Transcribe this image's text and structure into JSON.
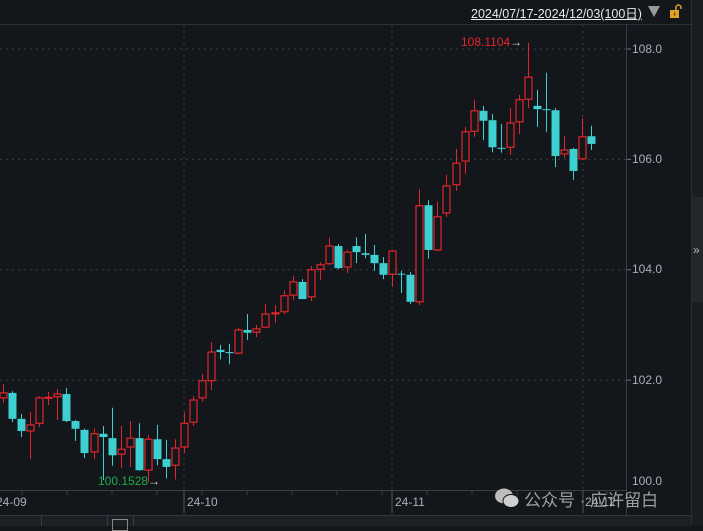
{
  "header": {
    "date_range": "2024/07/17-2024/12/03(100日)",
    "dropdown_icon": "triangle-down-icon",
    "lock_icon": "unlock-icon"
  },
  "price_axis": {
    "labels": [
      "108.0",
      "106.0",
      "104.0",
      "102.0",
      "100.0"
    ]
  },
  "time_axis": {
    "labels": [
      "24-09",
      "24-10",
      "24-11",
      "24-12"
    ]
  },
  "markers": {
    "max_label": "108.1104",
    "min_label": "100.1528",
    "arrow": "→"
  },
  "right_panel": {
    "expand_label": "»"
  },
  "watermark": {
    "text": "公众号 · 应许留白"
  },
  "colors": {
    "up": "#e0262b",
    "down": "#3ecfd0",
    "grid": "#3a3e45",
    "background": "#13161b"
  },
  "chart_data": {
    "type": "candlestick",
    "ylim": [
      100.0,
      108.2
    ],
    "yticks": [
      100,
      102,
      104,
      106,
      108
    ],
    "candles_ohlc": [
      [
        101.68,
        101.93,
        101.59,
        101.77
      ],
      [
        101.77,
        101.8,
        101.24,
        101.3
      ],
      [
        101.3,
        101.39,
        100.97,
        101.08
      ],
      [
        101.08,
        101.42,
        100.57,
        101.19
      ],
      [
        101.22,
        101.71,
        101.15,
        101.68
      ],
      [
        101.68,
        101.79,
        101.55,
        101.69
      ],
      [
        101.7,
        101.84,
        101.28,
        101.75
      ],
      [
        101.75,
        101.86,
        101.24,
        101.26
      ],
      [
        101.26,
        101.28,
        100.9,
        101.12
      ],
      [
        101.1,
        101.12,
        100.59,
        100.68
      ],
      [
        100.7,
        101.13,
        100.57,
        101.03
      ],
      [
        101.03,
        101.17,
        100.19,
        100.97
      ],
      [
        100.95,
        101.5,
        100.45,
        100.64
      ],
      [
        100.66,
        101.17,
        100.41,
        100.75
      ],
      [
        100.79,
        101.26,
        100.43,
        100.95
      ],
      [
        100.95,
        101.22,
        100.36,
        100.37
      ],
      [
        100.37,
        101.01,
        100.1528,
        100.93
      ],
      [
        100.93,
        101.19,
        100.46,
        100.57
      ],
      [
        100.57,
        100.92,
        100.22,
        100.43
      ],
      [
        100.46,
        100.93,
        100.2,
        100.77
      ],
      [
        100.79,
        101.42,
        100.68,
        101.22
      ],
      [
        101.24,
        101.71,
        101.17,
        101.64
      ],
      [
        101.68,
        102.11,
        101.61,
        101.99
      ],
      [
        101.99,
        102.69,
        101.82,
        102.51
      ],
      [
        102.55,
        102.64,
        102.38,
        102.51
      ],
      [
        102.51,
        102.66,
        102.29,
        102.49
      ],
      [
        102.49,
        102.95,
        102.47,
        102.91
      ],
      [
        102.91,
        103.2,
        102.73,
        102.86
      ],
      [
        102.87,
        103.0,
        102.78,
        102.93
      ],
      [
        102.96,
        103.38,
        102.96,
        103.2
      ],
      [
        103.21,
        103.36,
        103.04,
        103.22
      ],
      [
        103.24,
        103.62,
        103.2,
        103.53
      ],
      [
        103.54,
        103.89,
        103.45,
        103.78
      ],
      [
        103.78,
        103.83,
        103.47,
        103.47
      ],
      [
        103.51,
        104.07,
        103.43,
        104.0
      ],
      [
        104.01,
        104.14,
        103.82,
        104.09
      ],
      [
        104.11,
        104.58,
        104.09,
        104.43
      ],
      [
        104.43,
        104.47,
        104.01,
        104.03
      ],
      [
        104.05,
        104.36,
        103.94,
        104.32
      ],
      [
        104.43,
        104.59,
        104.12,
        104.32
      ],
      [
        104.3,
        104.65,
        104.21,
        104.27
      ],
      [
        104.27,
        104.45,
        103.98,
        104.12
      ],
      [
        104.12,
        104.23,
        103.83,
        103.91
      ],
      [
        103.92,
        104.36,
        103.69,
        104.34
      ],
      [
        103.93,
        103.98,
        103.58,
        103.92
      ],
      [
        103.91,
        103.96,
        103.38,
        103.42
      ],
      [
        103.42,
        105.46,
        103.36,
        105.16
      ],
      [
        105.17,
        105.26,
        104.2,
        104.36
      ],
      [
        104.36,
        105.23,
        104.34,
        104.96
      ],
      [
        105.03,
        105.72,
        104.96,
        105.52
      ],
      [
        105.54,
        106.19,
        105.43,
        105.93
      ],
      [
        105.97,
        106.59,
        105.74,
        106.5
      ],
      [
        106.51,
        107.08,
        106.41,
        106.88
      ],
      [
        106.88,
        106.97,
        106.35,
        106.7
      ],
      [
        106.71,
        106.82,
        106.13,
        106.22
      ],
      [
        106.21,
        106.64,
        106.12,
        106.2
      ],
      [
        106.22,
        106.93,
        106.08,
        106.66
      ],
      [
        106.68,
        107.17,
        106.46,
        107.08
      ],
      [
        107.09,
        108.1104,
        106.93,
        107.49
      ],
      [
        106.97,
        107.26,
        106.59,
        106.91
      ],
      [
        106.91,
        107.57,
        106.5,
        106.9
      ],
      [
        106.89,
        106.93,
        105.86,
        106.06
      ],
      [
        106.1,
        106.42,
        106.03,
        106.17
      ],
      [
        106.19,
        106.21,
        105.63,
        105.79
      ],
      [
        106.01,
        106.75,
        105.99,
        106.41
      ],
      [
        106.42,
        106.61,
        106.17,
        106.28
      ]
    ],
    "max": 108.1104,
    "min": 100.1528
  }
}
